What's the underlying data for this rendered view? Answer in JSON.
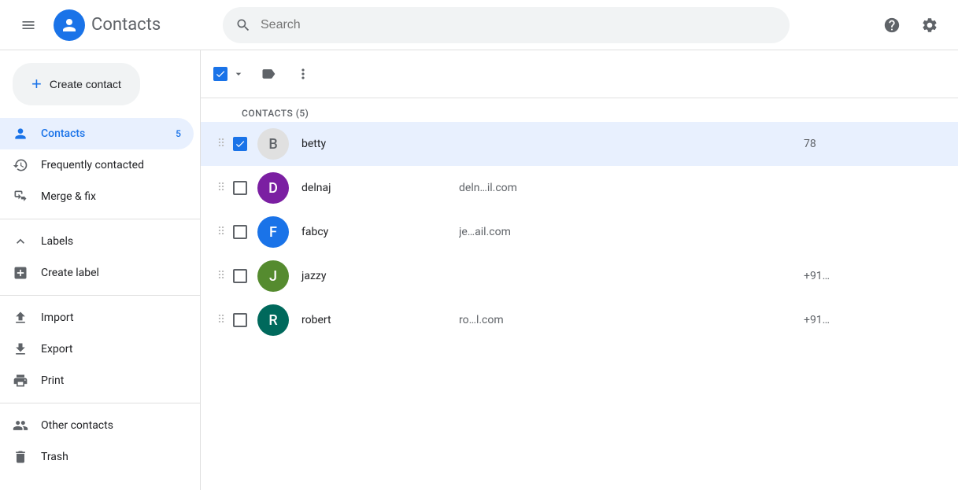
{
  "app": {
    "title": "Contacts"
  },
  "topbar": {
    "search_placeholder": "Search",
    "help_label": "Help",
    "settings_label": "Settings"
  },
  "sidebar": {
    "create_contact_label": "Create contact",
    "nav_items": [
      {
        "id": "contacts",
        "label": "Contacts",
        "badge": "5",
        "active": true,
        "icon": "person"
      },
      {
        "id": "frequently-contacted",
        "label": "Frequently contacted",
        "badge": "",
        "active": false,
        "icon": "history"
      },
      {
        "id": "merge-fix",
        "label": "Merge & fix",
        "badge": "",
        "active": false,
        "icon": "merge"
      }
    ],
    "labels_header": "Labels",
    "create_label": "Create label",
    "import_label": "Import",
    "export_label": "Export",
    "print_label": "Print",
    "other_contacts_label": "Other contacts",
    "trash_label": "Trash"
  },
  "contacts_list": {
    "header": "CONTACTS (5)",
    "contacts": [
      {
        "id": 1,
        "name": "betty",
        "email": "",
        "phone": "78",
        "avatar_color": "#ffffff",
        "avatar_text": "B",
        "selected": true,
        "avatar_type": "photo"
      },
      {
        "id": 2,
        "name": "delnaj",
        "email": "deln...il.com",
        "phone": "",
        "avatar_color": "#7b1fa2",
        "avatar_text": "d",
        "selected": false
      },
      {
        "id": 3,
        "name": "fabcy",
        "email": "je...ail.com",
        "phone": "",
        "avatar_color": "#1a73e8",
        "avatar_text": "f",
        "selected": false
      },
      {
        "id": 4,
        "name": "jazzy",
        "email": "",
        "phone": "+91...",
        "avatar_color": "#558b2f",
        "avatar_text": "j",
        "selected": false
      },
      {
        "id": 5,
        "name": "robert",
        "email": "ro...l.com",
        "phone": "+91...",
        "avatar_color": "#00695c",
        "avatar_text": "r",
        "selected": false
      }
    ]
  },
  "toolbar": {
    "label_icon_title": "Manage labels",
    "more_icon_title": "More options"
  }
}
